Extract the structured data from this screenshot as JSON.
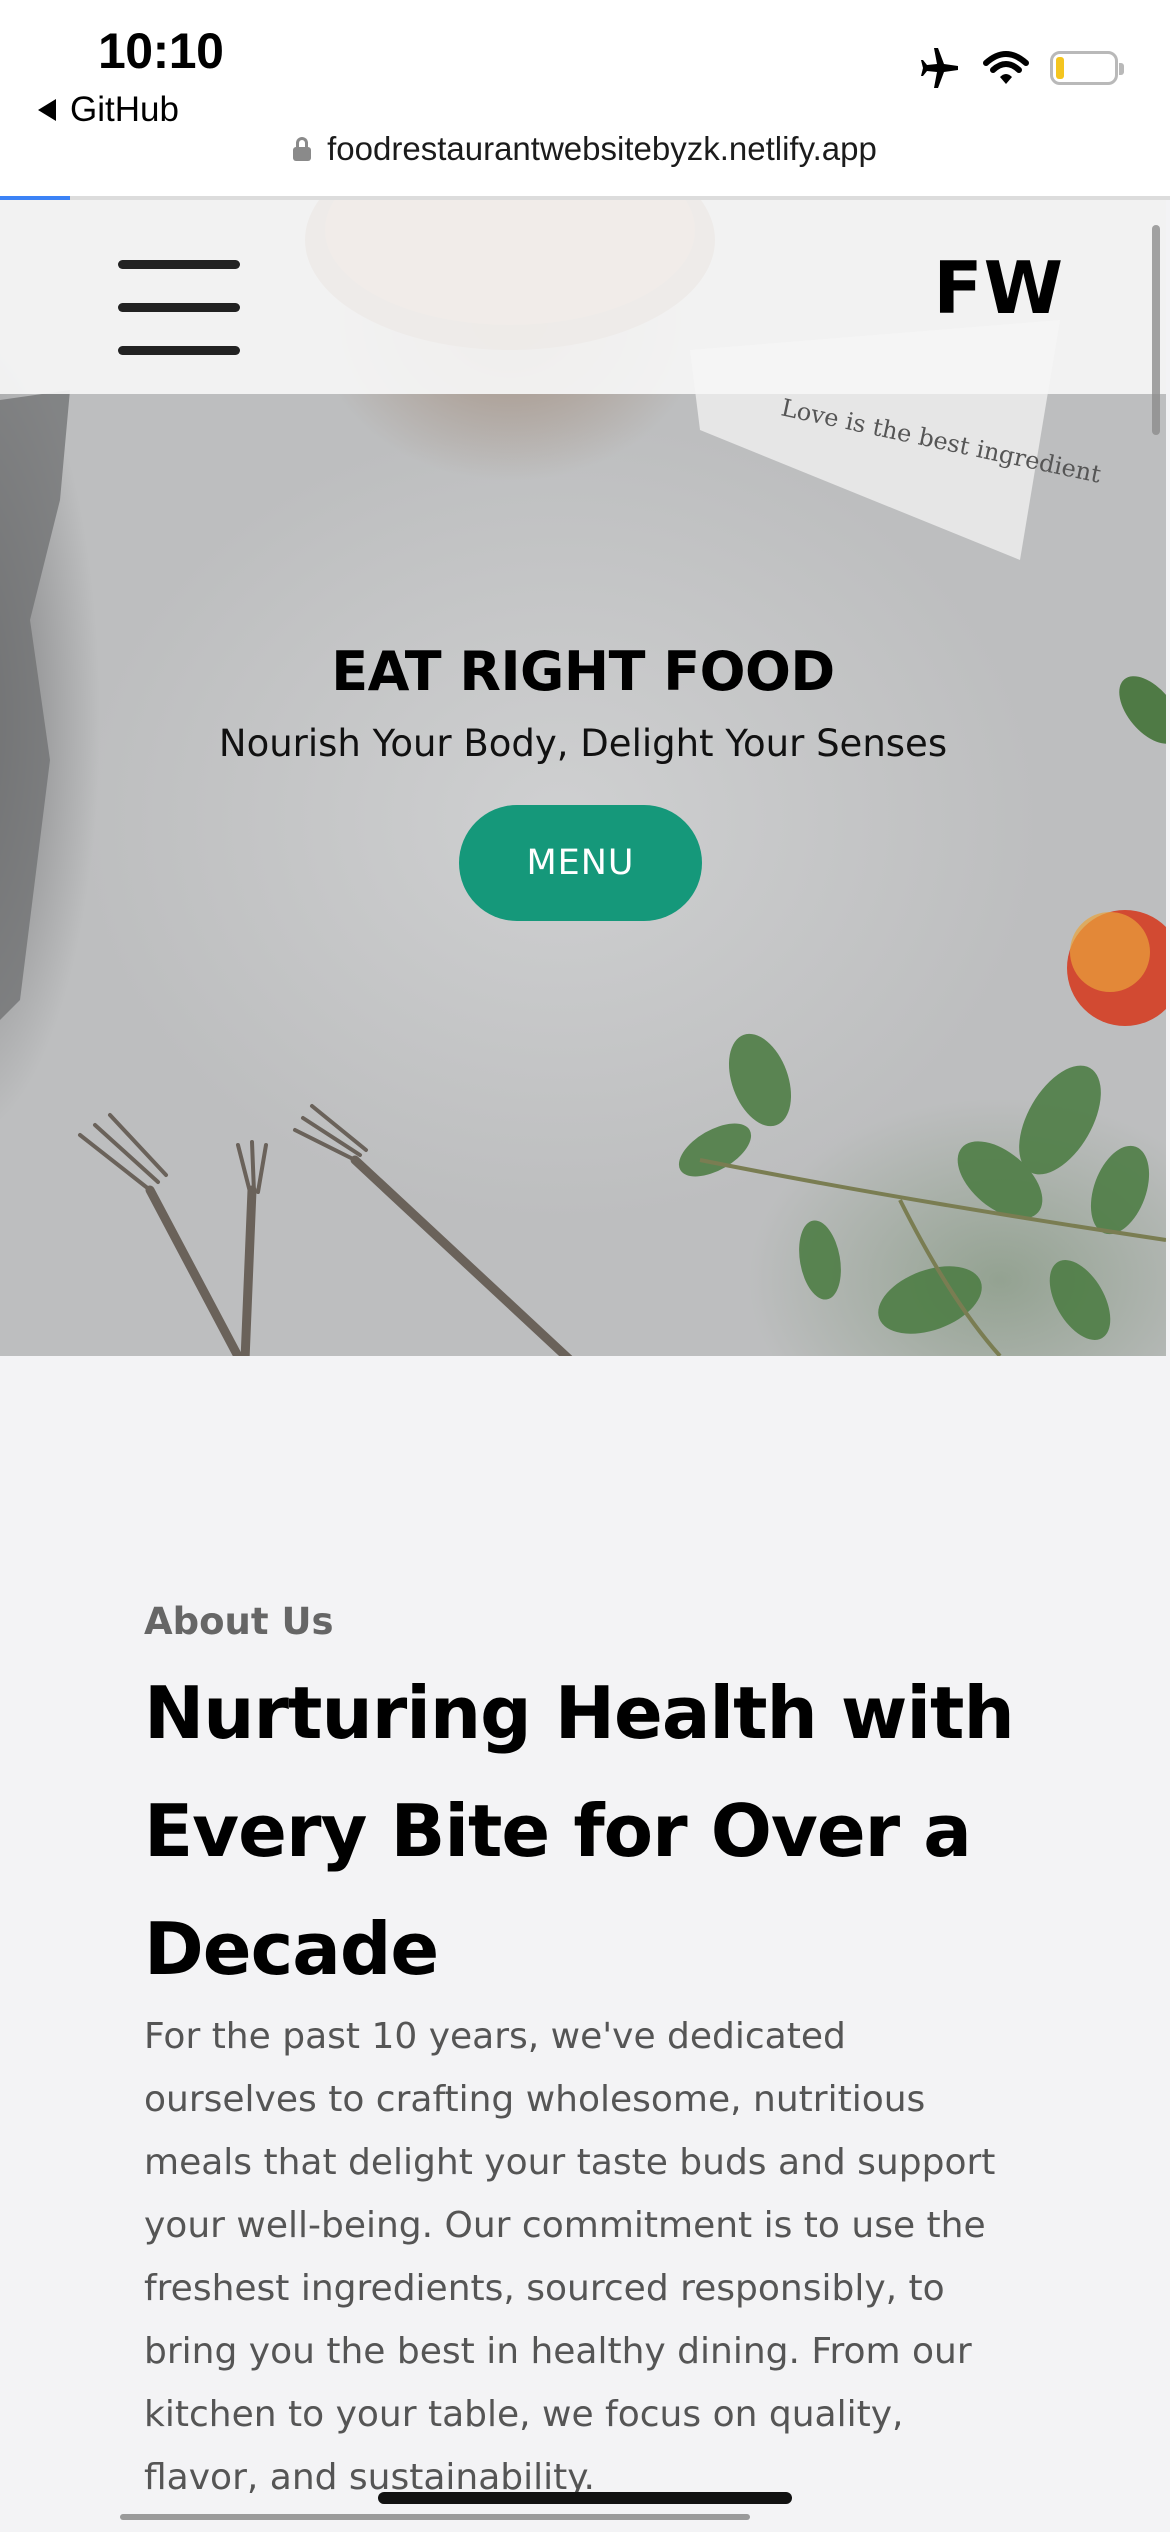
{
  "status_bar": {
    "time": "10:10",
    "back_app": "GitHub",
    "url": "foodrestaurantwebsitebyzk.netlify.app",
    "icons": [
      "airplane-icon",
      "wifi-icon",
      "battery-icon"
    ],
    "load_progress": 0.06
  },
  "nav": {
    "logo": "FW",
    "menu_icon": "hamburger-icon"
  },
  "hero": {
    "title": "EAT RIGHT FOOD",
    "subtitle": "Nourish Your Body, Delight Your Senses",
    "button_label": "MENU",
    "napkin_text": "Love is the best ingredient",
    "accent_color": "#15987a"
  },
  "about": {
    "label": "About Us",
    "heading": "Nurturing Health with Every Bite for Over a Decade",
    "body": "For the past 10 years, we've dedicated ourselves to crafting wholesome, nutritious meals that delight your taste buds and support your well-being. Our commitment is to use the freshest ingredients, sourced responsibly, to bring you the best in healthy dining. From our kitchen to your table, we focus on quality, flavor, and sustainability."
  }
}
